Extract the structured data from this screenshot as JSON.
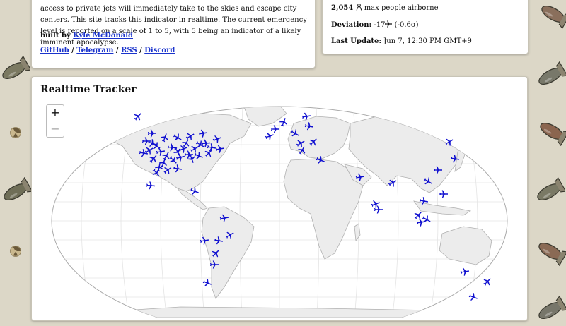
{
  "about": {
    "description": "access to private jets will immediately take to the skies and escape city centers. This site tracks this indicator in realtime. The current emergency level is reported on a scale of 1 to 5, with 5 being an indicator of a likely imminent apocalypse.",
    "built_by_prefix": "built by",
    "author": "Kyle McDonald",
    "links": [
      "GitHub",
      "Telegram",
      "RSS",
      "Discord"
    ],
    "separator": " / "
  },
  "stats": {
    "max_airborne_value": "2,054",
    "max_airborne_icon": "person-icon",
    "max_airborne_label": "max people airborne",
    "deviation_label": "Deviation:",
    "deviation_value": "-17",
    "deviation_icon": "plane-icon",
    "deviation_sigma": "(-0.6σ)",
    "last_update_label": "Last Update:",
    "last_update_value": "Jun 7, 12:30 PM GMT+9"
  },
  "tracker": {
    "title": "Realtime Tracker",
    "zoom_in": "+",
    "zoom_out": "−",
    "plane_color": "#1010d0"
  },
  "background": {
    "color": "#dcd7c7",
    "decorations": [
      "bomb-icon",
      "radiation-icon"
    ]
  }
}
